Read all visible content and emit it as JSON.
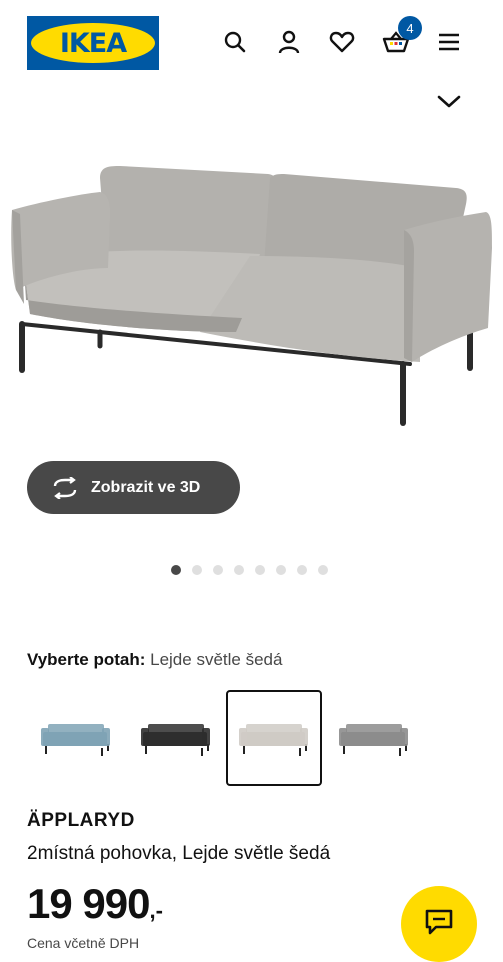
{
  "header": {
    "logo_text": "IKEA",
    "cart_count": "4",
    "icons": [
      "search-icon",
      "user-icon",
      "heart-icon",
      "cart-icon",
      "menu-icon"
    ]
  },
  "gallery": {
    "view3d_label": "Zobrazit ve 3D",
    "image_count": 8,
    "active_index": 0
  },
  "cover": {
    "label": "Vyberte potah:",
    "value": "Lejde světle šedá",
    "options": [
      {
        "name": "blue",
        "color": "#7fa3b5"
      },
      {
        "name": "black",
        "color": "#2e2e2e"
      },
      {
        "name": "light-grey",
        "color": "#cfcbc5"
      },
      {
        "name": "grey",
        "color": "#8c8c8c"
      }
    ],
    "selected_index": 2
  },
  "product": {
    "name": "ÄPPLARYD",
    "description": "2místná pohovka, Lejde světle šedá",
    "price_main": "19 990",
    "price_suffix": ",-",
    "vat_note": "Cena včetně DPH"
  },
  "colors": {
    "brand_blue": "#0058a3",
    "brand_yellow": "#ffdb00",
    "button_dark": "#484848"
  }
}
